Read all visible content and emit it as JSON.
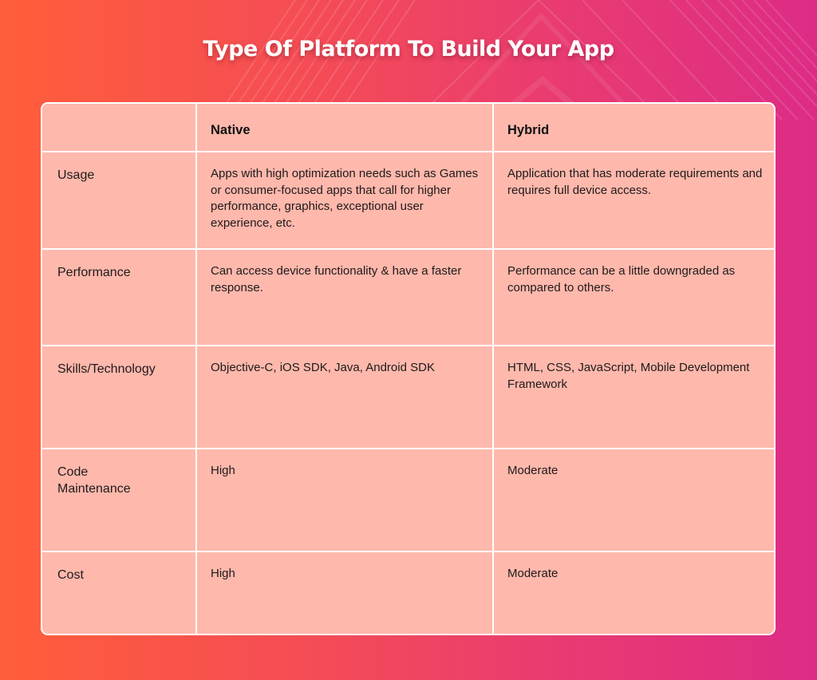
{
  "title": "Type Of Platform To Build Your App",
  "colors": {
    "background_start": "#FF5E3A",
    "background_end": "#DD2C86",
    "cell_fill": "#FFB8AC",
    "grid_lines": "#FFFFFF",
    "title_text": "#FFFFFF"
  },
  "table": {
    "headers": [
      "",
      "Native",
      "Hybrid"
    ],
    "rows": [
      {
        "label": "Usage",
        "native": "Apps with high optimization needs such as Games or consumer-focused apps that call for higher performance, graphics, exceptional user experience, etc.",
        "hybrid": "Application that has moderate requirements and requires full device access."
      },
      {
        "label": "Performance",
        "native": "Can access device functionality & have a faster response.",
        "hybrid": "Performance can be a little downgraded as compared to others."
      },
      {
        "label": "Skills/Technology",
        "native": "Objective-C, iOS SDK, Java, Android SDK",
        "hybrid": "HTML, CSS, JavaScript, Mobile Development Framework"
      },
      {
        "label": "Code Maintenance",
        "native": "High",
        "hybrid": "Moderate"
      },
      {
        "label": "Cost",
        "native": "High",
        "hybrid": "Moderate"
      }
    ]
  }
}
